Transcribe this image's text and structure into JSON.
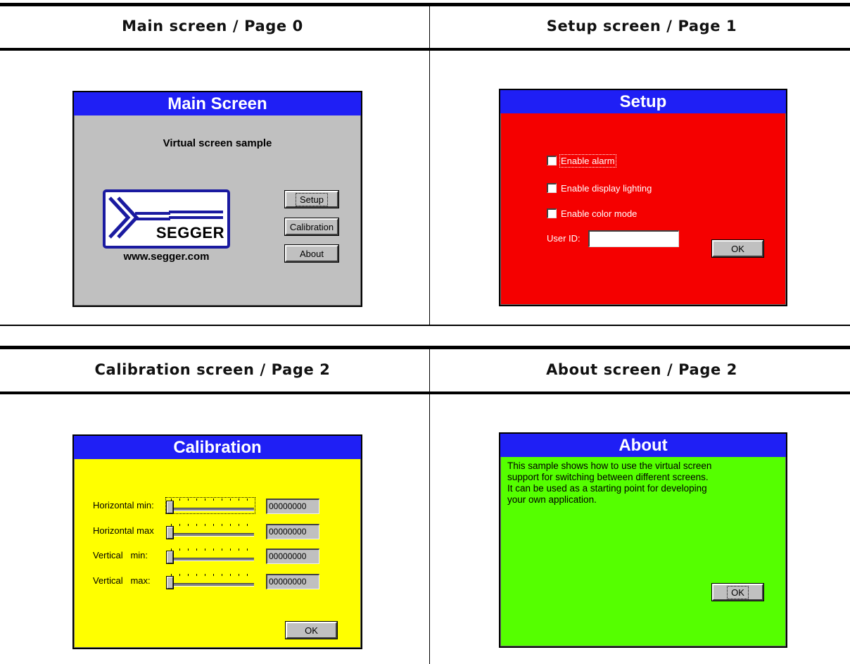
{
  "cells": {
    "main": {
      "caption": "Main screen / Page 0"
    },
    "setup": {
      "caption": "Setup screen / Page 1"
    },
    "calibration": {
      "caption": "Calibration screen / Page 2"
    },
    "about": {
      "caption": "About screen / Page 2"
    }
  },
  "main_window": {
    "title": "Main Screen",
    "subtitle": "Virtual screen sample",
    "logo_text": "SEGGER",
    "url": "www.segger.com",
    "buttons": {
      "setup": "Setup",
      "calibration": "Calibration",
      "about": "About"
    },
    "focused_button": "Setup"
  },
  "setup_window": {
    "title": "Setup",
    "checkboxes": [
      {
        "label": "Enable alarm",
        "checked": false
      },
      {
        "label": "Enable display lighting",
        "checked": false
      },
      {
        "label": "Enable color mode",
        "checked": false
      }
    ],
    "user_id_label": "User ID:",
    "user_id_value": "",
    "ok_label": "OK"
  },
  "calibration_window": {
    "title": "Calibration",
    "rows": [
      {
        "label": "Horizontal min:",
        "value": "00000000"
      },
      {
        "label": "Horizontal max",
        "value": "00000000"
      },
      {
        "label": "Vertical   min:",
        "value": "00000000"
      },
      {
        "label": "Vertical   max:",
        "value": "00000000"
      }
    ],
    "ok_label": "OK"
  },
  "about_window": {
    "title": "About",
    "text": "This sample shows how to use the virtual screen\nsupport for switching between different screens.\nIt can be used as a starting point for developing\nyour own application.",
    "ok_label": "OK"
  },
  "colors": {
    "title_bar": "#1f1ff5",
    "main_bg": "#c0c0c0",
    "setup_bg": "#f50000",
    "calibration_bg": "#ffff00",
    "about_bg": "#55ff00",
    "logo_blue": "#1a1aa0"
  }
}
